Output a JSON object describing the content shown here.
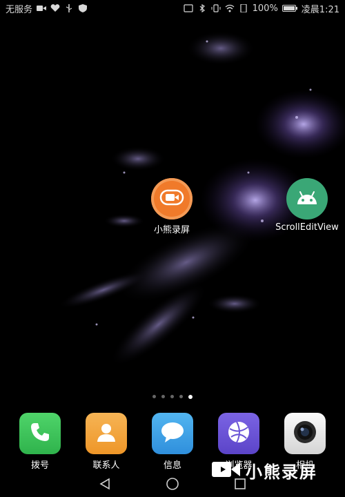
{
  "status_bar": {
    "carrier": "无服务",
    "battery_percent": "100%",
    "time": "凌晨1:21"
  },
  "desktop": {
    "apps": [
      {
        "label": "小熊录屏",
        "icon": "video-camera-icon",
        "color": "#f07a2a"
      },
      {
        "label": "ScrollEditView",
        "icon": "android-icon",
        "color": "#3aa776"
      }
    ],
    "page_count": 5,
    "active_page": 5
  },
  "dock": {
    "apps": [
      {
        "label": "拨号",
        "icon": "phone-icon",
        "color": "#3bc45a"
      },
      {
        "label": "联系人",
        "icon": "contact-icon",
        "color": "#f2a23a"
      },
      {
        "label": "信息",
        "icon": "message-icon",
        "color": "#3aa0e6"
      },
      {
        "label": "浏览器",
        "icon": "browser-globe-icon",
        "color": "#6a54d6"
      },
      {
        "label": "相机",
        "icon": "camera-icon",
        "color": "#e8e8e8"
      }
    ]
  },
  "nav_bar": {
    "back_icon": "back-triangle-icon",
    "home_icon": "home-circle-icon",
    "recent_icon": "recent-square-icon"
  },
  "watermark": {
    "text": "小熊录屏",
    "icon": "video-camera-icon"
  }
}
